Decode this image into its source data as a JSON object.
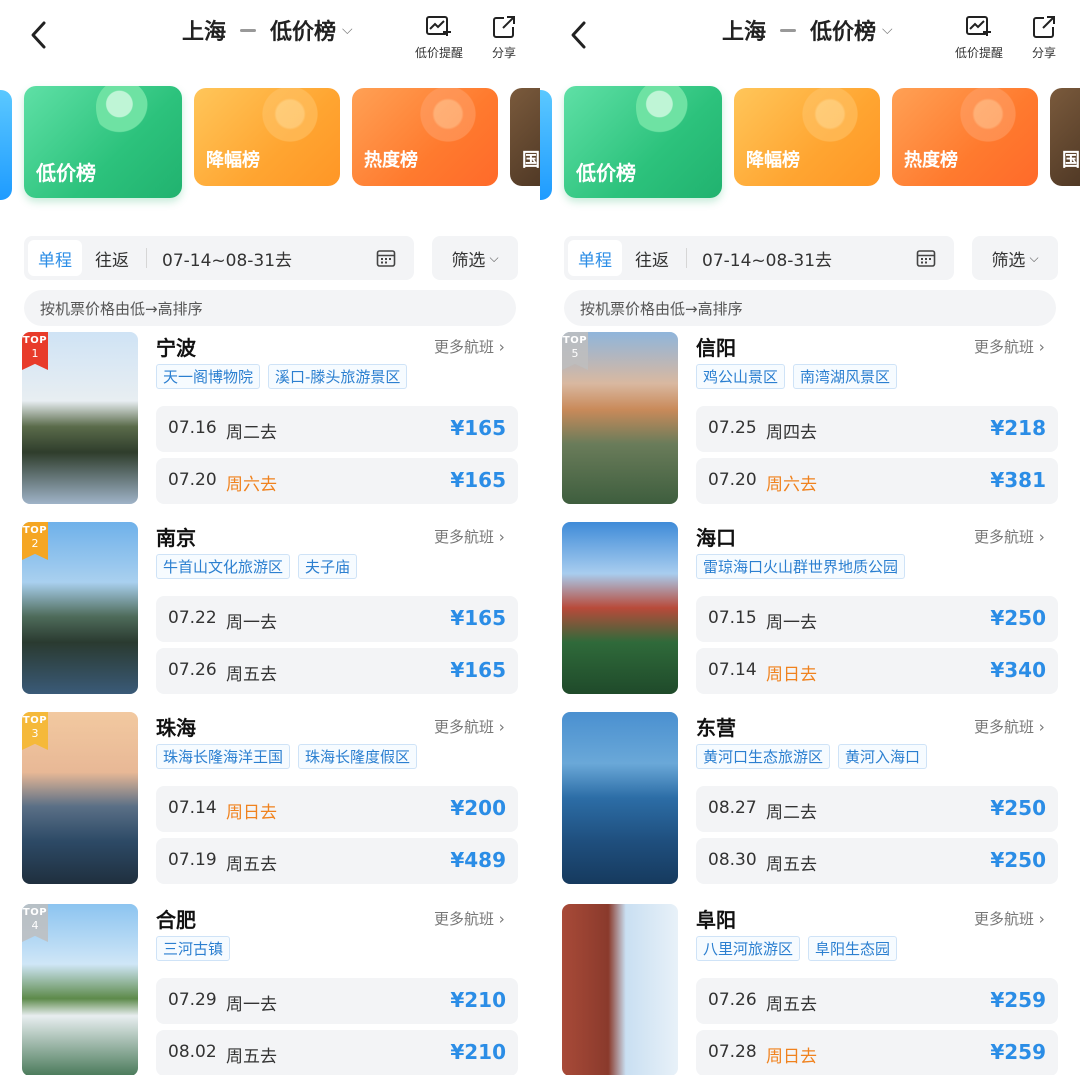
{
  "panels": [
    {
      "header": {
        "origin": "上海",
        "destination": "低价榜",
        "alert_label": "低价提醒",
        "share_label": "分享"
      },
      "categories": {
        "low": "低价榜",
        "drop": "降幅榜",
        "hot": "热度榜",
        "intl": "国"
      },
      "filter": {
        "one_way": "单程",
        "round_trip": "往返",
        "date_range": "07-14~08-31去",
        "filter_label": "筛选"
      },
      "sort_note": "按机票价格由低→高排序",
      "destinations": [
        {
          "rank_label": "TOP",
          "rank": "1",
          "city": "宁波",
          "more": "更多航班",
          "tags": [
            "天一阁博物院",
            "溪口-滕头旅游景区"
          ],
          "fares": [
            {
              "date": "07.16",
              "weekday": "周二去",
              "weekend": false,
              "price": "¥165"
            },
            {
              "date": "07.20",
              "weekday": "周六去",
              "weekend": true,
              "price": "¥165"
            }
          ]
        },
        {
          "rank_label": "TOP",
          "rank": "2",
          "city": "南京",
          "more": "更多航班",
          "tags": [
            "牛首山文化旅游区",
            "夫子庙"
          ],
          "fares": [
            {
              "date": "07.22",
              "weekday": "周一去",
              "weekend": false,
              "price": "¥165"
            },
            {
              "date": "07.26",
              "weekday": "周五去",
              "weekend": false,
              "price": "¥165"
            }
          ]
        },
        {
          "rank_label": "TOP",
          "rank": "3",
          "city": "珠海",
          "more": "更多航班",
          "tags": [
            "珠海长隆海洋王国",
            "珠海长隆度假区"
          ],
          "fares": [
            {
              "date": "07.14",
              "weekday": "周日去",
              "weekend": true,
              "price": "¥200"
            },
            {
              "date": "07.19",
              "weekday": "周五去",
              "weekend": false,
              "price": "¥489"
            }
          ]
        },
        {
          "rank_label": "TOP",
          "rank": "4",
          "city": "合肥",
          "more": "更多航班",
          "tags": [
            "三河古镇"
          ],
          "fares": [
            {
              "date": "07.29",
              "weekday": "周一去",
              "weekend": false,
              "price": "¥210"
            },
            {
              "date": "08.02",
              "weekday": "周五去",
              "weekend": false,
              "price": "¥210"
            }
          ]
        }
      ]
    },
    {
      "header": {
        "origin": "上海",
        "destination": "低价榜",
        "alert_label": "低价提醒",
        "share_label": "分享"
      },
      "categories": {
        "low": "低价榜",
        "drop": "降幅榜",
        "hot": "热度榜",
        "intl": "国"
      },
      "filter": {
        "one_way": "单程",
        "round_trip": "往返",
        "date_range": "07-14~08-31去",
        "filter_label": "筛选"
      },
      "sort_note": "按机票价格由低→高排序",
      "destinations": [
        {
          "rank_label": "TOP",
          "rank": "5",
          "city": "信阳",
          "more": "更多航班",
          "tags": [
            "鸡公山景区",
            "南湾湖风景区"
          ],
          "fares": [
            {
              "date": "07.25",
              "weekday": "周四去",
              "weekend": false,
              "price": "¥218"
            },
            {
              "date": "07.20",
              "weekday": "周六去",
              "weekend": true,
              "price": "¥381"
            }
          ]
        },
        {
          "rank_label": "",
          "rank": "",
          "city": "海口",
          "more": "更多航班",
          "tags": [
            "雷琼海口火山群世界地质公园"
          ],
          "fares": [
            {
              "date": "07.15",
              "weekday": "周一去",
              "weekend": false,
              "price": "¥250"
            },
            {
              "date": "07.14",
              "weekday": "周日去",
              "weekend": true,
              "price": "¥340"
            }
          ]
        },
        {
          "rank_label": "",
          "rank": "",
          "city": "东营",
          "more": "更多航班",
          "tags": [
            "黄河口生态旅游区",
            "黄河入海口"
          ],
          "fares": [
            {
              "date": "08.27",
              "weekday": "周二去",
              "weekend": false,
              "price": "¥250"
            },
            {
              "date": "08.30",
              "weekday": "周五去",
              "weekend": false,
              "price": "¥250"
            }
          ]
        },
        {
          "rank_label": "",
          "rank": "",
          "city": "阜阳",
          "more": "更多航班",
          "tags": [
            "八里河旅游区",
            "阜阳生态园"
          ],
          "fares": [
            {
              "date": "07.26",
              "weekday": "周五去",
              "weekend": false,
              "price": "¥259"
            },
            {
              "date": "07.28",
              "weekday": "周日去",
              "weekend": true,
              "price": "¥259"
            }
          ]
        }
      ]
    }
  ],
  "colors": {
    "accent_blue": "#2b8de6",
    "weekend_orange": "#f0821e",
    "price_blue": "#2b8de6"
  },
  "icons": {
    "back": "chevron-left-icon",
    "alert": "price-alert-chart-icon",
    "share": "share-icon",
    "calendar": "calendar-icon",
    "more": "chevron-right-icon"
  }
}
